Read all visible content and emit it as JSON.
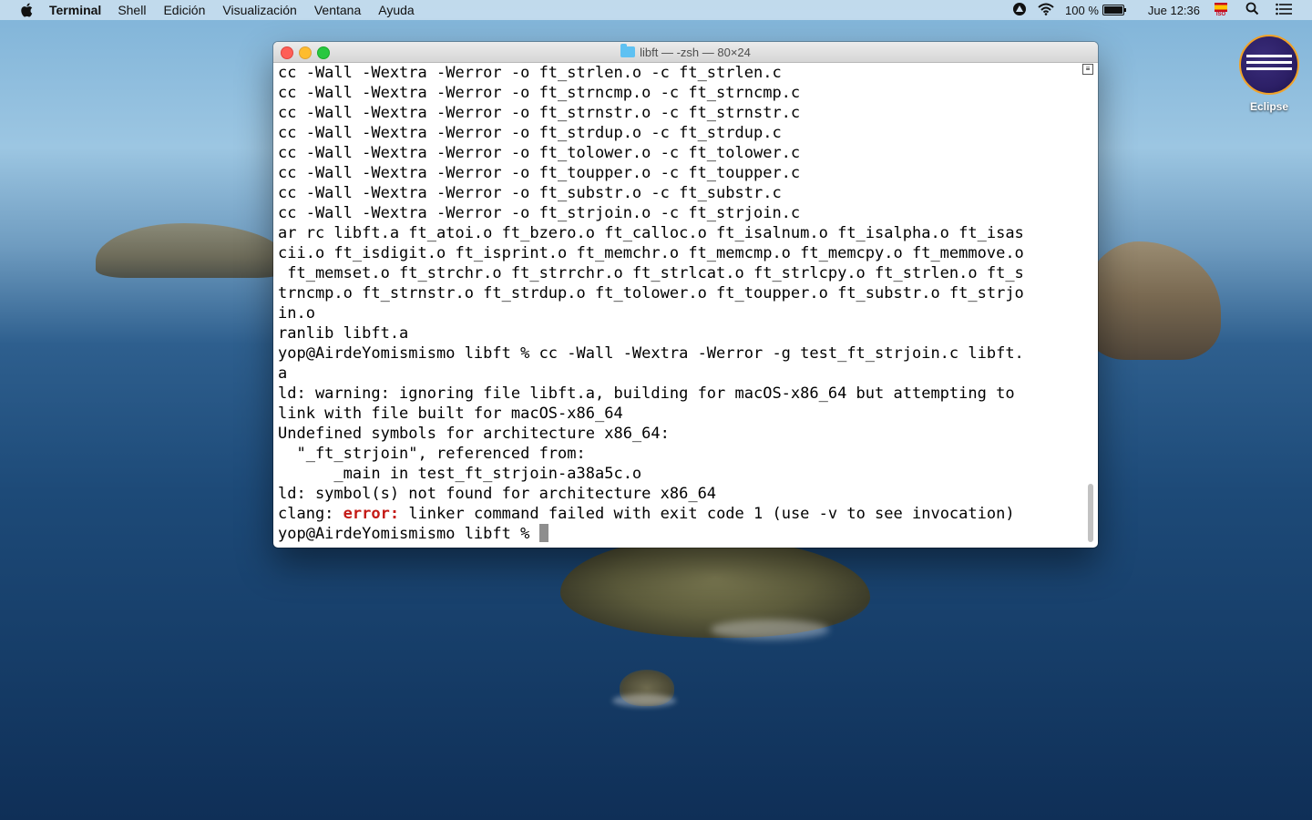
{
  "menubar": {
    "app_name": "Terminal",
    "menus": [
      "Shell",
      "Edición",
      "Visualización",
      "Ventana",
      "Ayuda"
    ],
    "battery": "100 %",
    "clock": "Jue 12:36",
    "input_source": "ISO"
  },
  "window": {
    "title": "libft — -zsh — 80×24"
  },
  "terminal": {
    "lines": [
      "cc -Wall -Wextra -Werror -o ft_strlen.o -c ft_strlen.c",
      "cc -Wall -Wextra -Werror -o ft_strncmp.o -c ft_strncmp.c",
      "cc -Wall -Wextra -Werror -o ft_strnstr.o -c ft_strnstr.c",
      "cc -Wall -Wextra -Werror -o ft_strdup.o -c ft_strdup.c",
      "cc -Wall -Wextra -Werror -o ft_tolower.o -c ft_tolower.c",
      "cc -Wall -Wextra -Werror -o ft_toupper.o -c ft_toupper.c",
      "cc -Wall -Wextra -Werror -o ft_substr.o -c ft_substr.c",
      "cc -Wall -Wextra -Werror -o ft_strjoin.o -c ft_strjoin.c",
      "ar rc libft.a ft_atoi.o ft_bzero.o ft_calloc.o ft_isalnum.o ft_isalpha.o ft_isas",
      "cii.o ft_isdigit.o ft_isprint.o ft_memchr.o ft_memcmp.o ft_memcpy.o ft_memmove.o",
      " ft_memset.o ft_strchr.o ft_strrchr.o ft_strlcat.o ft_strlcpy.o ft_strlen.o ft_s",
      "trncmp.o ft_strnstr.o ft_strdup.o ft_tolower.o ft_toupper.o ft_substr.o ft_strjo",
      "in.o",
      "ranlib libft.a",
      "yop@AirdeYomismismo libft % cc -Wall -Wextra -Werror -g test_ft_strjoin.c libft.",
      "a",
      "ld: warning: ignoring file libft.a, building for macOS-x86_64 but attempting to",
      "link with file built for macOS-x86_64",
      "Undefined symbols for architecture x86_64:",
      "  \"_ft_strjoin\", referenced from:",
      "      _main in test_ft_strjoin-a38a5c.o",
      "ld: symbol(s) not found for architecture x86_64"
    ],
    "error_line_prefix": "clang: ",
    "error_word": "error:",
    "error_line_rest": " linker command failed with exit code 1 (use -v to see invocation)",
    "prompt": "yop@AirdeYomismismo libft % "
  },
  "desktop": {
    "icon_label": "Eclipse"
  }
}
